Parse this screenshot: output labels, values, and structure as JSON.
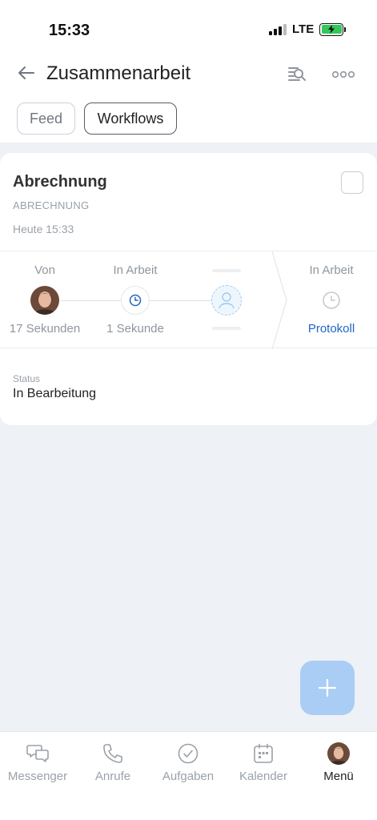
{
  "status_bar": {
    "time": "15:33",
    "network": "LTE"
  },
  "header": {
    "title": "Zusammenarbeit"
  },
  "tabs": [
    {
      "label": "Feed",
      "selected": false
    },
    {
      "label": "Workflows",
      "selected": true
    }
  ],
  "card": {
    "title": "Abrechnung",
    "subtitle": "ABRECHNUNG",
    "date": "Heute 15:33",
    "steps": [
      {
        "label": "Von",
        "sub": "17 Sekunden"
      },
      {
        "label": "In Arbeit",
        "sub": "1 Sekunde"
      },
      {
        "label": "In Arbeit",
        "sub": "Protokoll"
      }
    ],
    "status_label": "Status",
    "status_value": "In Bearbeitung"
  },
  "bottom_nav": [
    {
      "label": "Messenger",
      "icon": "chat-icon",
      "active": false
    },
    {
      "label": "Anrufe",
      "icon": "phone-icon",
      "active": false
    },
    {
      "label": "Aufgaben",
      "icon": "check-circle-icon",
      "active": false
    },
    {
      "label": "Kalender",
      "icon": "calendar-icon",
      "active": false
    },
    {
      "label": "Menü",
      "icon": "avatar",
      "active": true
    }
  ],
  "colors": {
    "accent": "#2066c4",
    "fab": "#aacdf5",
    "battery": "#32c759"
  }
}
